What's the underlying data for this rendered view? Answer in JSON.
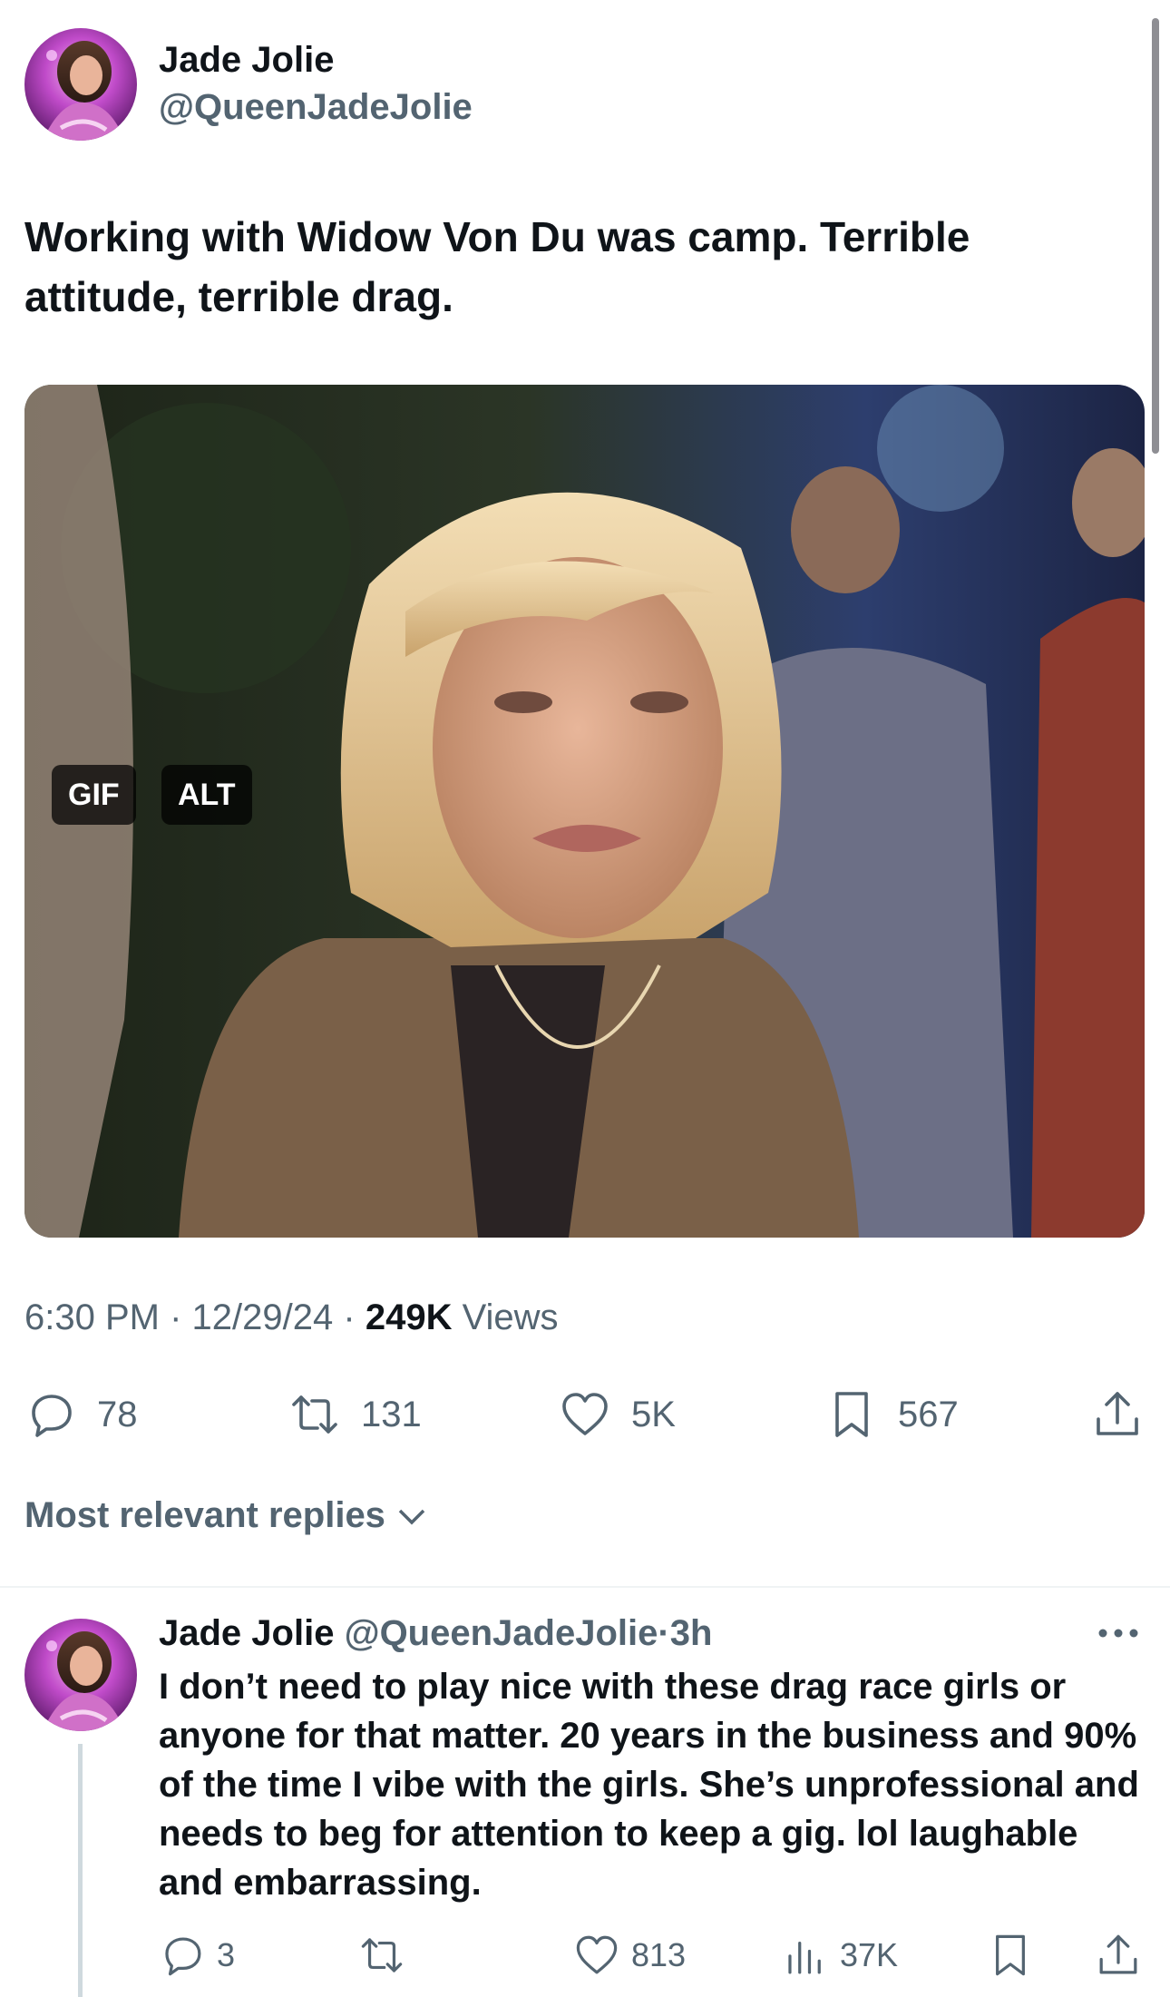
{
  "main_tweet": {
    "author_name": "Jade Jolie",
    "author_handle": "@QueenJadeJolie",
    "text": "Working with Widow Von Du was camp. Terrible attitude, terrible drag.",
    "media": {
      "gif_label": "GIF",
      "alt_label": "ALT"
    },
    "time": "6:30 PM",
    "date": "12/29/24",
    "separator": "·",
    "views_count": "249K",
    "views_label": "Views",
    "stats": {
      "replies": "78",
      "reposts": "131",
      "likes": "5K",
      "bookmarks": "567"
    }
  },
  "replies_sort": {
    "label": "Most relevant replies"
  },
  "reply": {
    "author_name": "Jade Jolie",
    "author_handle": "@QueenJadeJolie",
    "separator": "·",
    "time_ago": "3h",
    "text": "I don’t need to play nice with these drag race girls or anyone for that matter. 20 years in the business and 90% of the time I vibe with the girls. She’s unprofessional and needs to beg for attention to keep a gig. lol laughable and embarrassing.",
    "stats": {
      "replies": "3",
      "reposts": "",
      "likes": "813",
      "views": "37K"
    }
  },
  "icons": {
    "reply": "speech-bubble-icon",
    "repost": "repost-arrows-icon",
    "like": "heart-icon",
    "bookmark": "bookmark-icon",
    "share": "share-upload-icon",
    "views": "bar-chart-icon",
    "more": "more-dots-icon",
    "sort": "chevron-down-icon"
  },
  "colors": {
    "text": "#0f1419",
    "secondary": "#536471",
    "divider": "#eff3f4"
  }
}
